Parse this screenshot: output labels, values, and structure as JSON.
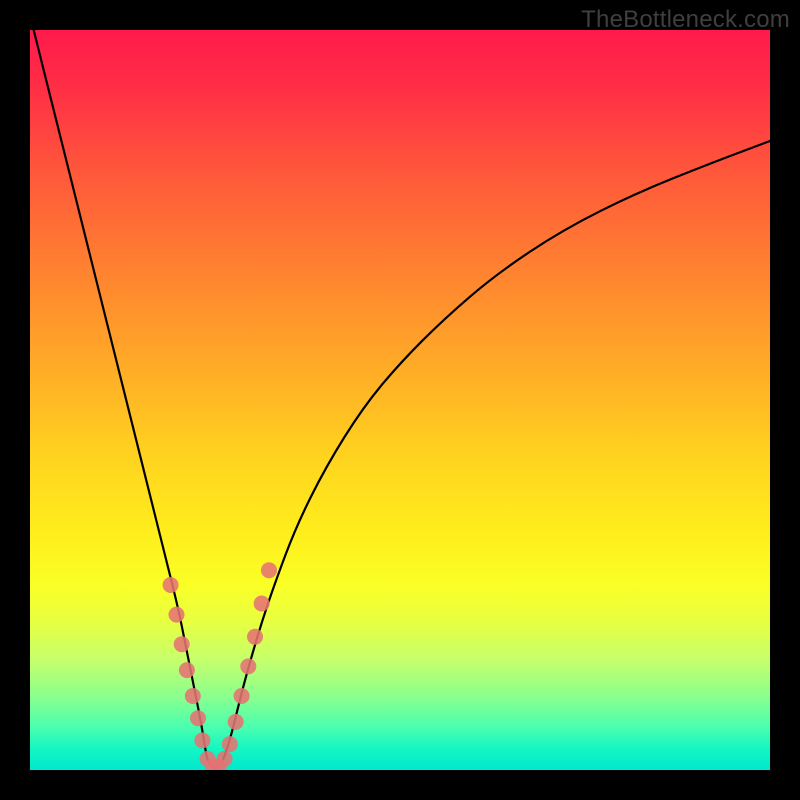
{
  "watermark": "TheBottleneck.com",
  "chart_data": {
    "type": "line",
    "title": "",
    "xlabel": "",
    "ylabel": "",
    "xlim": [
      0,
      100
    ],
    "ylim": [
      0,
      100
    ],
    "series": [
      {
        "name": "bottleneck-curve",
        "x": [
          0.5,
          3,
          6,
          9,
          12,
          14,
          16,
          18,
          20,
          21,
          22,
          23,
          23.5,
          24,
          25,
          26,
          27,
          28,
          29,
          31,
          33,
          36,
          40,
          45,
          50,
          56,
          63,
          72,
          82,
          92,
          100
        ],
        "values": [
          100,
          90,
          78,
          66,
          54,
          46,
          38,
          30,
          22,
          17,
          12,
          7,
          4,
          1,
          0,
          1,
          4,
          8,
          12,
          19,
          25,
          33,
          41,
          49,
          55,
          61,
          67,
          73,
          78,
          82,
          85
        ]
      }
    ],
    "markers": {
      "name": "highlight-dots",
      "x": [
        19,
        19.8,
        20.5,
        21.2,
        22,
        22.7,
        23.3,
        24,
        24.7,
        25.5,
        26.3,
        27,
        27.8,
        28.6,
        29.5,
        30.4,
        31.3,
        32.3
      ],
      "y": [
        25,
        21,
        17,
        13.5,
        10,
        7,
        4,
        1.5,
        0.5,
        0.5,
        1.5,
        3.5,
        6.5,
        10,
        14,
        18,
        22.5,
        27
      ]
    },
    "gradient_stops": [
      {
        "pos": 0,
        "color": "#ff1a4b"
      },
      {
        "pos": 20,
        "color": "#ff5a3a"
      },
      {
        "pos": 48,
        "color": "#ffb325"
      },
      {
        "pos": 68,
        "color": "#ffee1c"
      },
      {
        "pos": 85,
        "color": "#c6ff6a"
      },
      {
        "pos": 100,
        "color": "#00e8cf"
      }
    ]
  }
}
